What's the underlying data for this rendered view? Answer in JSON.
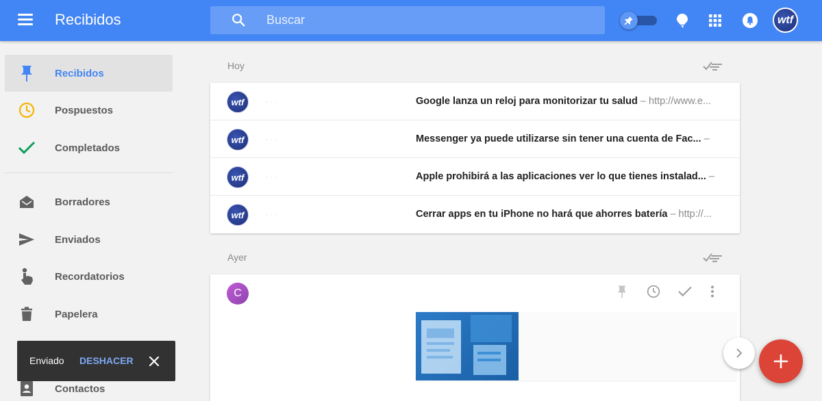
{
  "header": {
    "title": "Recibidos",
    "menu_icon": "hamburger-menu-icon",
    "search_placeholder": "Buscar",
    "avatar_text": "wtf",
    "accent": "#4285f4"
  },
  "sidebar": {
    "items": [
      {
        "label": "Recibidos",
        "icon": "pin-icon",
        "active": true
      },
      {
        "label": "Pospuestos",
        "icon": "clock-icon"
      },
      {
        "label": "Completados",
        "icon": "check-icon"
      },
      {
        "label": "Borradores",
        "icon": "draft-envelope-icon"
      },
      {
        "label": "Enviados",
        "icon": "send-icon"
      },
      {
        "label": "Recordatorios",
        "icon": "reminder-hand-icon"
      },
      {
        "label": "Papelera",
        "icon": "trash-icon"
      },
      {
        "label": "Contactos",
        "icon": "contacts-icon"
      }
    ]
  },
  "main": {
    "sections": [
      {
        "label": "Hoy",
        "rows": [
          {
            "avatar": "wtf",
            "subject": "Google lanza un reloj para monitorizar tu salud",
            "snippet": " – http://www.e..."
          },
          {
            "avatar": "wtf",
            "subject": "Messenger ya puede utilizarse sin tener una cuenta de Fac...",
            "snippet": " –"
          },
          {
            "avatar": "wtf",
            "subject": "Apple prohibirá a las aplicaciones ver lo que tienes instalad...",
            "snippet": " –"
          },
          {
            "avatar": "wtf",
            "subject": "Cerrar apps en tu iPhone no hará que ahorres batería",
            "snippet": " – http://..."
          }
        ]
      },
      {
        "label": "Ayer",
        "card": {
          "avatar": "C"
        }
      }
    ]
  },
  "snackbar": {
    "text": "Enviado",
    "action": "DESHACER"
  },
  "colors": {
    "fab_red": "#db4437",
    "snackbar_bg": "#323232",
    "snackbar_action": "#7fa9f5",
    "pospuestos_icon": "#f4b400",
    "completados_icon": "#0f9d58"
  }
}
